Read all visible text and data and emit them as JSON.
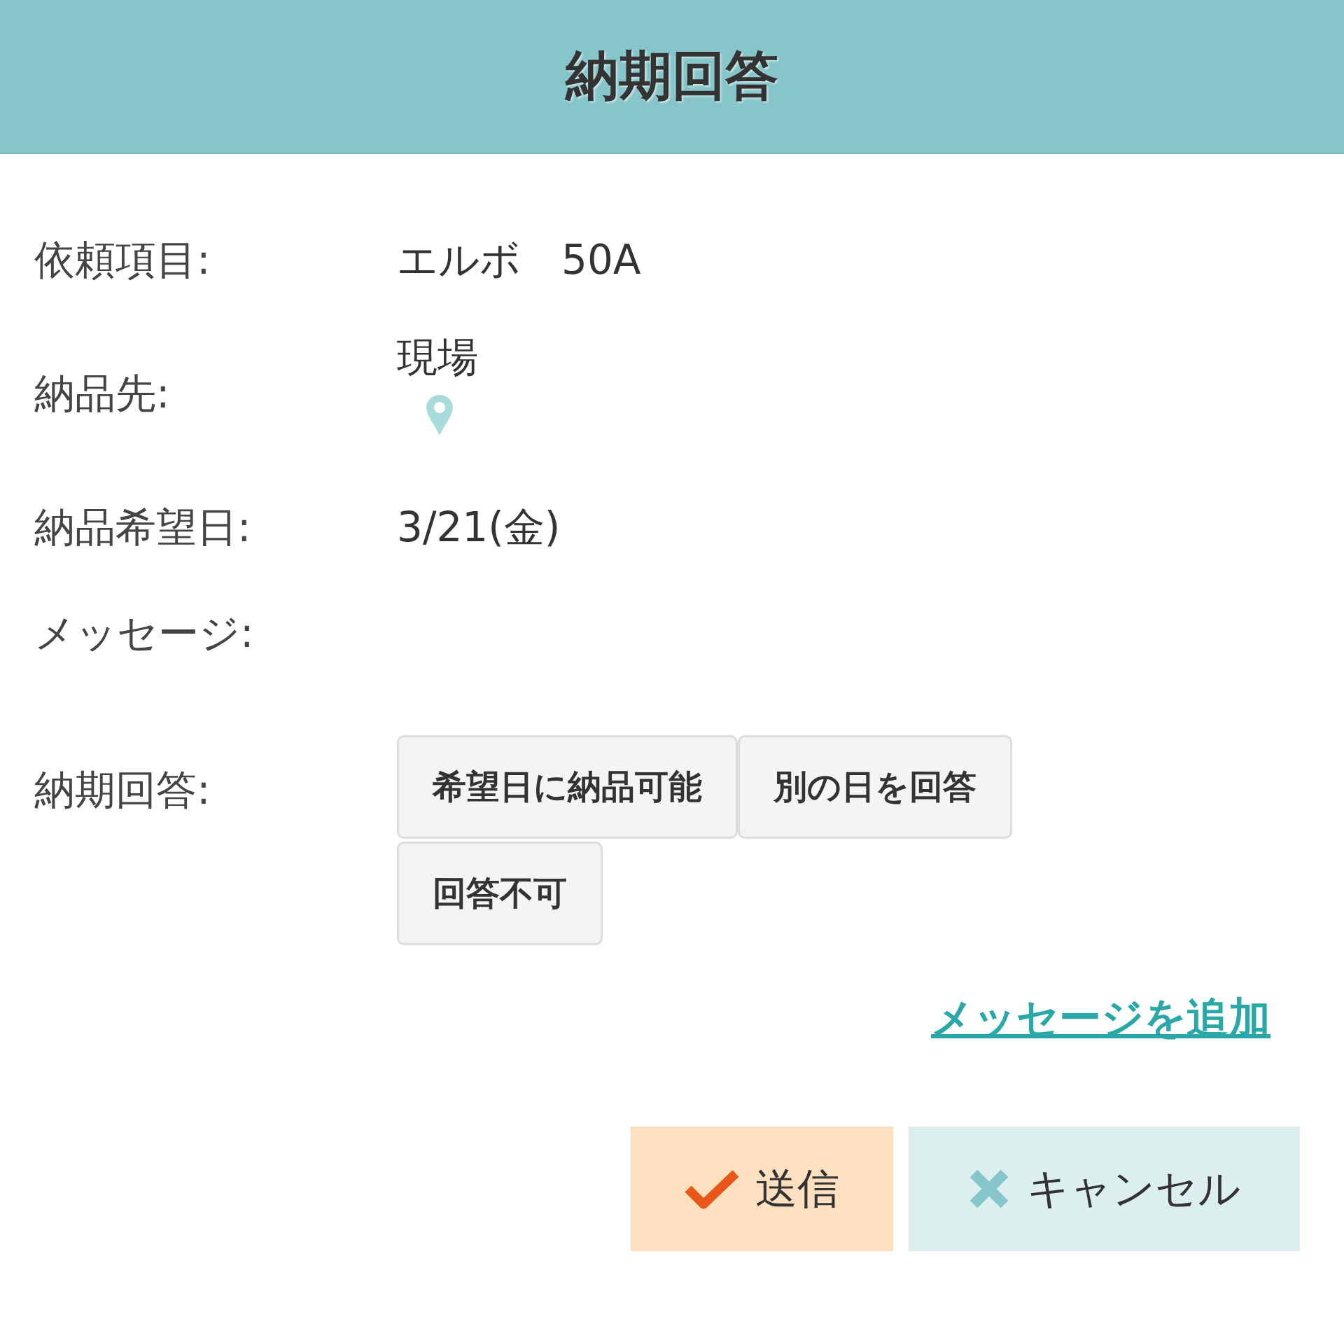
{
  "dialog": {
    "title": "納期回答"
  },
  "fields": [
    {
      "kind": "text",
      "label": "依頼項目:",
      "value": "エルボ　50A"
    },
    {
      "kind": "location",
      "label": "納品先:",
      "value": "現場"
    },
    {
      "kind": "text",
      "label": "納品希望日:",
      "value": "3/21(金)"
    },
    {
      "kind": "text",
      "label": "メッセージ:"
    }
  ],
  "answer": {
    "label": "納期回答:",
    "options": [
      {
        "label": "希望日に納品可能",
        "selected": false
      },
      {
        "label": "別の日を回答",
        "selected": false
      },
      {
        "label": "回答不可",
        "selected": false
      }
    ]
  },
  "add_message_link": "メッセージを追加",
  "buttons": [
    {
      "kind": "send",
      "label": "送信"
    },
    {
      "kind": "cancel",
      "label": "キャンセル"
    }
  ]
}
